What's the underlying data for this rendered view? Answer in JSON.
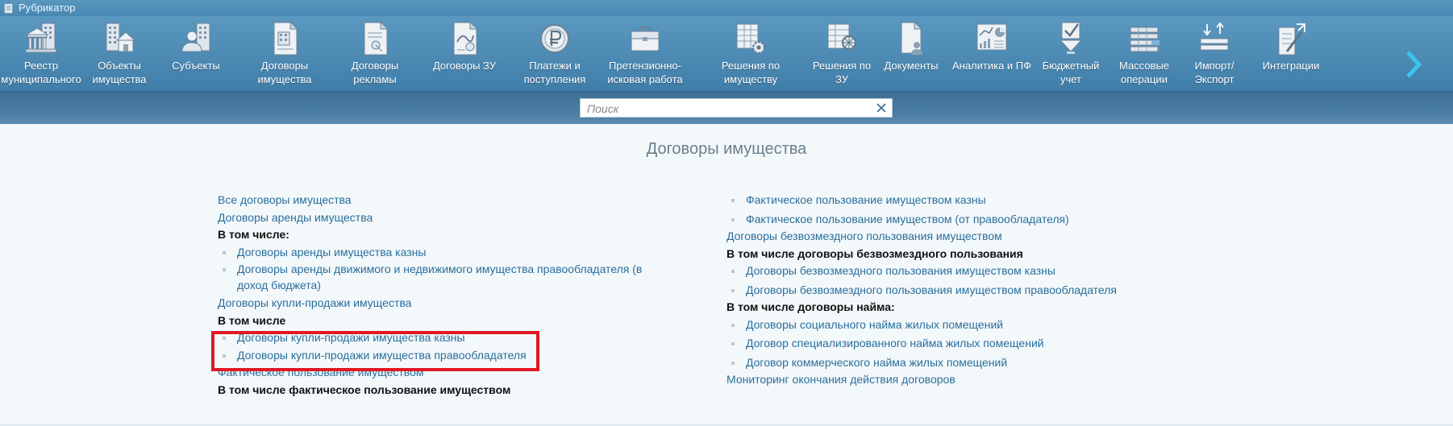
{
  "window": {
    "title": "Рубрикатор"
  },
  "ribbon": [
    {
      "label": "Реестр муниципального имущества",
      "icon": "building-columns-icon"
    },
    {
      "label": "Объекты имущества",
      "icon": "buildings-house-icon"
    },
    {
      "label": "Субъекты",
      "icon": "person-building-icon"
    },
    {
      "label": "Договоры имущества",
      "icon": "contract-building-icon"
    },
    {
      "label": "Договоры рекламы",
      "icon": "contract-ad-icon"
    },
    {
      "label": "Договоры ЗУ",
      "icon": "contract-land-icon"
    },
    {
      "label": "Платежи и поступления",
      "icon": "ruble-coin-icon"
    },
    {
      "label": "Претензионно-исковая работа",
      "icon": "briefcase-icon"
    },
    {
      "label": "Решения по имуществу",
      "icon": "grid-gear-icon"
    },
    {
      "label": "Решения по ЗУ",
      "icon": "grid-wheel-icon"
    },
    {
      "label": "Документы",
      "icon": "document-user-icon"
    },
    {
      "label": "Аналитика и ПФ",
      "icon": "analytics-icon"
    },
    {
      "label": "Бюджетный учет",
      "icon": "checkbox-arrow-icon"
    },
    {
      "label": "Массовые операции",
      "icon": "table-rows-icon"
    },
    {
      "label": "Импорт/ Экспорт",
      "icon": "import-export-icon"
    },
    {
      "label": "Интеграции",
      "icon": "document-pen-icon"
    }
  ],
  "search": {
    "placeholder": "Поиск"
  },
  "page": {
    "title": "Договоры имущества"
  },
  "left_column": [
    {
      "kind": "link",
      "text": "Все договоры имущества"
    },
    {
      "kind": "link",
      "text": "Договоры аренды имущества"
    },
    {
      "kind": "header",
      "text": "В том числе:"
    },
    {
      "kind": "bullet",
      "text": "Договоры аренды имущества казны"
    },
    {
      "kind": "bullet",
      "text": "Договоры аренды движимого и недвижимого имущества правообладателя (в доход бюджета)"
    },
    {
      "kind": "link",
      "text": "Договоры купли-продажи имущества"
    },
    {
      "kind": "header",
      "text": "В том числе"
    },
    {
      "kind": "bullet",
      "text": "Договоры купли-продажи имущества казны"
    },
    {
      "kind": "bullet",
      "text": "Договоры купли-продажи имущества правообладателя"
    },
    {
      "kind": "link",
      "text": "Фактическое пользование имуществом"
    },
    {
      "kind": "header",
      "text": "В том числе фактическое пользование имуществом"
    }
  ],
  "right_column": [
    {
      "kind": "bullet",
      "text": "Фактическое пользование имуществом казны"
    },
    {
      "kind": "bullet",
      "text": "Фактическое пользование имуществом (от правообладателя)"
    },
    {
      "kind": "link",
      "text": "Договоры безвозмездного пользования имуществом"
    },
    {
      "kind": "header",
      "text": "В том числе договоры безвозмездного пользования"
    },
    {
      "kind": "bullet",
      "text": "Договоры безвозмездного пользования имуществом казны"
    },
    {
      "kind": "bullet",
      "text": "Договоры безвозмездного пользования имуществом правообладателя"
    },
    {
      "kind": "header",
      "text": "В том числе договоры найма:"
    },
    {
      "kind": "bullet",
      "text": "Договоры социального найма жилых помещений"
    },
    {
      "kind": "bullet",
      "text": "Договор специализированного найма жилых помещений"
    },
    {
      "kind": "bullet",
      "text": "Договор коммерческого найма жилых помещений"
    },
    {
      "kind": "link",
      "text": "Мониторинг окончания действия договоров"
    }
  ],
  "colors": {
    "link": "#2a6e9b",
    "ribbon": "#4b89b3",
    "highlight": "#e01822"
  }
}
